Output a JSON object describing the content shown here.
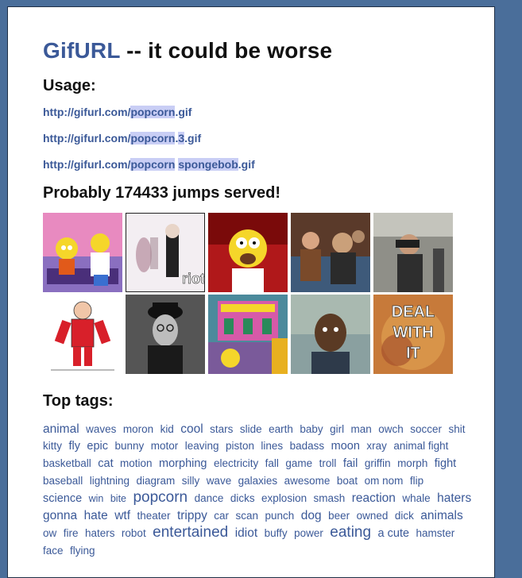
{
  "header": {
    "brand": "GifURL",
    "tagline": " -- it could be worse"
  },
  "usage": {
    "title": "Usage:",
    "lines": [
      [
        {
          "text": "http://gifurl.com/",
          "hl": false
        },
        {
          "text": "popcorn",
          "hl": true
        },
        {
          "text": ".gif",
          "hl": false
        }
      ],
      [
        {
          "text": "http://gifurl.com/",
          "hl": false
        },
        {
          "text": "popcorn",
          "hl": true
        },
        {
          "text": ".",
          "hl": false
        },
        {
          "text": "3",
          "hl": true
        },
        {
          "text": ".gif",
          "hl": false
        }
      ],
      [
        {
          "text": "http://gifurl.com/",
          "hl": false
        },
        {
          "text": "popcorn",
          "hl": true
        },
        {
          "text": " ",
          "hl": false
        },
        {
          "text": "spongebob",
          "hl": true
        },
        {
          "text": ".gif",
          "hl": false
        }
      ]
    ]
  },
  "served": {
    "text": "Probably 174433 jumps served!"
  },
  "thumbnails": [
    {
      "name": "simpsons-couch-gif",
      "caption": ""
    },
    {
      "name": "riot-gif",
      "caption": "riot"
    },
    {
      "name": "homer-shocked-gif",
      "caption": ""
    },
    {
      "name": "audience-reaction-gif",
      "caption": ""
    },
    {
      "name": "binoculars-gif",
      "caption": ""
    },
    {
      "name": "cartoon-man-red-gif",
      "caption": ""
    },
    {
      "name": "man-bowler-hat-gif",
      "caption": ""
    },
    {
      "name": "krusty-clown-college-gif",
      "caption": ""
    },
    {
      "name": "boy-reaction-gif",
      "caption": ""
    },
    {
      "name": "deal-with-it-gif",
      "caption": "DEAL WITH IT"
    }
  ],
  "tags_section": {
    "title": "Top tags:",
    "tags": [
      {
        "text": "animal",
        "size": "t15"
      },
      {
        "text": "waves",
        "size": "t13"
      },
      {
        "text": "moron",
        "size": "t13"
      },
      {
        "text": "kid",
        "size": "t13"
      },
      {
        "text": "cool",
        "size": "t15"
      },
      {
        "text": "stars",
        "size": "t13"
      },
      {
        "text": "slide",
        "size": "t13"
      },
      {
        "text": "earth",
        "size": "t13"
      },
      {
        "text": "baby",
        "size": "t13"
      },
      {
        "text": "girl",
        "size": "t13"
      },
      {
        "text": "man",
        "size": "t13"
      },
      {
        "text": "owch",
        "size": "t13"
      },
      {
        "text": "soccer",
        "size": "t13"
      },
      {
        "text": "shit",
        "size": "t13"
      },
      {
        "text": "kitty",
        "size": "t13"
      },
      {
        "text": "fly",
        "size": "t14"
      },
      {
        "text": "epic",
        "size": "t14"
      },
      {
        "text": "bunny",
        "size": "t13"
      },
      {
        "text": "motor",
        "size": "t13"
      },
      {
        "text": "leaving",
        "size": "t13"
      },
      {
        "text": "piston",
        "size": "t13"
      },
      {
        "text": "lines",
        "size": "t13"
      },
      {
        "text": "badass",
        "size": "t13"
      },
      {
        "text": "moon",
        "size": "t14"
      },
      {
        "text": "xray",
        "size": "t13"
      },
      {
        "text": "animal fight",
        "size": "t13"
      },
      {
        "text": "basketball",
        "size": "t13"
      },
      {
        "text": "cat",
        "size": "t14"
      },
      {
        "text": "motion",
        "size": "t13"
      },
      {
        "text": "morphing",
        "size": "t14"
      },
      {
        "text": "electricity",
        "size": "t13"
      },
      {
        "text": "fall",
        "size": "t13"
      },
      {
        "text": "game",
        "size": "t13"
      },
      {
        "text": "troll",
        "size": "t13"
      },
      {
        "text": "fail",
        "size": "t14"
      },
      {
        "text": "griffin",
        "size": "t13"
      },
      {
        "text": "morph",
        "size": "t13"
      },
      {
        "text": "fight",
        "size": "t14"
      },
      {
        "text": "baseball",
        "size": "t13"
      },
      {
        "text": "lightning",
        "size": "t13"
      },
      {
        "text": "diagram",
        "size": "t13"
      },
      {
        "text": "silly",
        "size": "t13"
      },
      {
        "text": "wave",
        "size": "t13"
      },
      {
        "text": "galaxies",
        "size": "t13"
      },
      {
        "text": "awesome",
        "size": "t13"
      },
      {
        "text": "boat",
        "size": "t13"
      },
      {
        "text": "om nom",
        "size": "t13"
      },
      {
        "text": "flip",
        "size": "t13"
      },
      {
        "text": "science",
        "size": "t14"
      },
      {
        "text": "win",
        "size": "t12"
      },
      {
        "text": "bite",
        "size": "t12"
      },
      {
        "text": "popcorn",
        "size": "t19"
      },
      {
        "text": "dance",
        "size": "t13"
      },
      {
        "text": "dicks",
        "size": "t13"
      },
      {
        "text": "explosion",
        "size": "t13"
      },
      {
        "text": "smash",
        "size": "t13"
      },
      {
        "text": "reaction",
        "size": "t15"
      },
      {
        "text": "whale",
        "size": "t13"
      },
      {
        "text": "haters gonna",
        "size": "t15"
      },
      {
        "text": "hate",
        "size": "t15"
      },
      {
        "text": "wtf",
        "size": "t15"
      },
      {
        "text": "theater",
        "size": "t13"
      },
      {
        "text": "trippy",
        "size": "t15"
      },
      {
        "text": "car",
        "size": "t13"
      },
      {
        "text": "scan",
        "size": "t13"
      },
      {
        "text": "punch",
        "size": "t13"
      },
      {
        "text": "dog",
        "size": "t15"
      },
      {
        "text": "beer",
        "size": "t13"
      },
      {
        "text": "owned",
        "size": "t13"
      },
      {
        "text": "dick",
        "size": "t13"
      },
      {
        "text": "animals",
        "size": "t15"
      },
      {
        "text": "ow",
        "size": "t13"
      },
      {
        "text": "fire",
        "size": "t13"
      },
      {
        "text": "haters",
        "size": "t13"
      },
      {
        "text": "robot",
        "size": "t13"
      },
      {
        "text": "entertained",
        "size": "t19"
      },
      {
        "text": "idiot",
        "size": "t15"
      },
      {
        "text": "buffy",
        "size": "t13"
      },
      {
        "text": "power",
        "size": "t13"
      },
      {
        "text": "eating",
        "size": "t19"
      },
      {
        "text": "a cute",
        "size": "t14"
      },
      {
        "text": "hamster",
        "size": "t13"
      },
      {
        "text": "face",
        "size": "t13"
      },
      {
        "text": "flying",
        "size": "t13"
      }
    ]
  }
}
